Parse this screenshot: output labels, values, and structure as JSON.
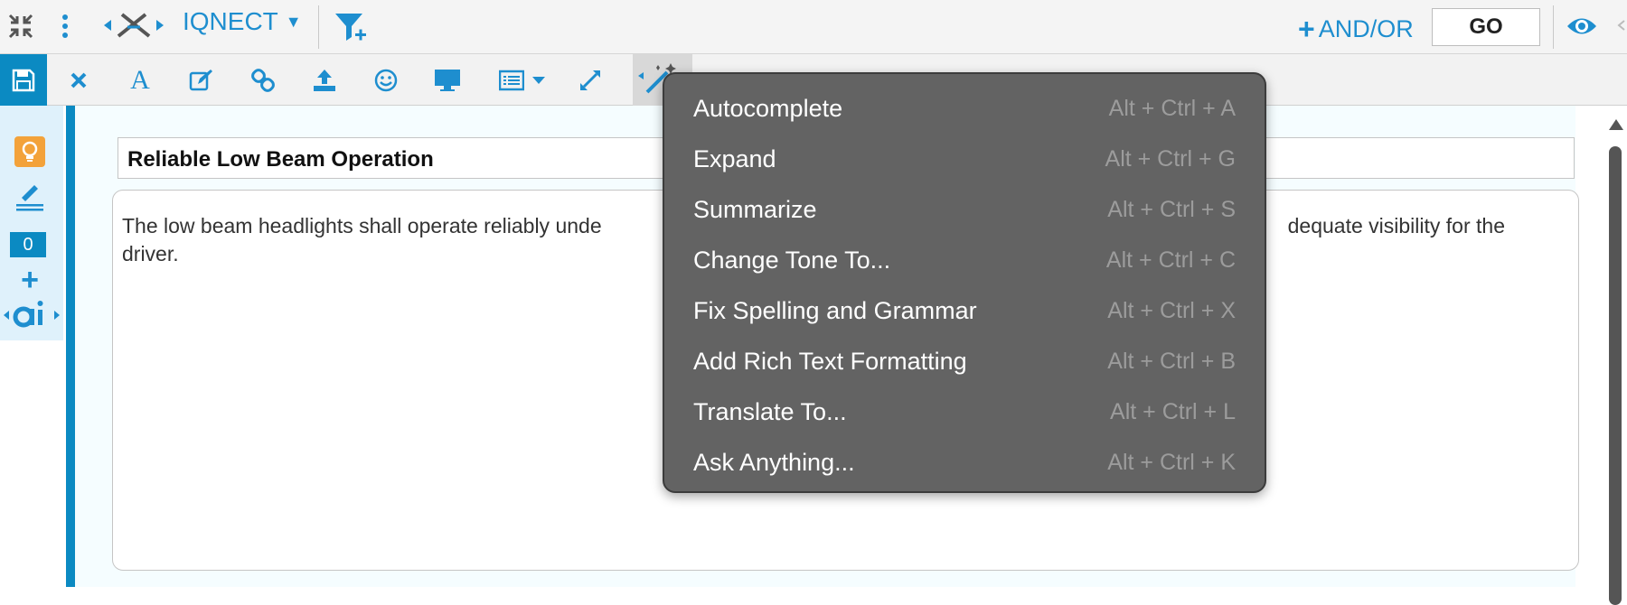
{
  "header": {
    "brand": "IQNECT",
    "andor_label": "AND/OR",
    "go_label": "GO"
  },
  "sidebar": {
    "count": "0"
  },
  "editor": {
    "title": "Reliable Low Beam Operation",
    "body_left": "The low beam headlights shall operate reliably unde",
    "body_right": "dequate visibility for the",
    "body_line2": "driver."
  },
  "menu": {
    "items": [
      {
        "label": "Autocomplete",
        "shortcut": "Alt + Ctrl + A"
      },
      {
        "label": "Expand",
        "shortcut": "Alt + Ctrl + G"
      },
      {
        "label": "Summarize",
        "shortcut": "Alt + Ctrl + S"
      },
      {
        "label": "Change Tone To...",
        "shortcut": "Alt + Ctrl + C"
      },
      {
        "label": "Fix Spelling and Grammar",
        "shortcut": "Alt + Ctrl + X"
      },
      {
        "label": "Add Rich Text Formatting",
        "shortcut": "Alt + Ctrl + B"
      },
      {
        "label": "Translate To...",
        "shortcut": "Alt + Ctrl + L"
      },
      {
        "label": "Ask Anything...",
        "shortcut": "Alt + Ctrl + K"
      }
    ]
  },
  "colors": {
    "accent": "#0b8ac2",
    "link": "#1e8ecf",
    "menu_bg": "#636363"
  },
  "icons": {
    "collapse": "collapse-icon",
    "more": "more-vertical-icon",
    "network": "network-icon",
    "filter_add": "filter-add-icon",
    "eye": "eye-icon",
    "save": "save-icon",
    "close": "close-icon",
    "font": "font-icon",
    "edit": "edit-icon",
    "link": "link-icon",
    "upload": "upload-icon",
    "emoji": "smiley-icon",
    "monitor": "monitor-icon",
    "list": "list-icon",
    "expand": "expand-icon",
    "magic": "magic-wand-icon",
    "lightbulb": "lightbulb-icon",
    "pen": "pen-lines-icon",
    "plus": "plus-icon",
    "ai": "ai-icon"
  }
}
